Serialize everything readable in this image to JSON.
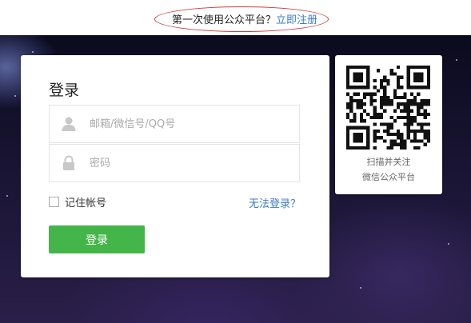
{
  "header": {
    "question": "第一次使用公众平台？",
    "register_link": "立即注册"
  },
  "login": {
    "title": "登录",
    "username_placeholder": "邮箱/微信号/QQ号",
    "password_placeholder": "密码",
    "remember_label": "记住帐号",
    "forgot_link": "无法登录？",
    "submit_label": "登录"
  },
  "qr": {
    "line1": "扫描并关注",
    "line2": "微信公众平台"
  },
  "colors": {
    "accent_green": "#44b549",
    "link_blue": "#3a7bc8",
    "annotation_red": "#d03a3a"
  },
  "icons": [
    "user-icon",
    "lock-icon",
    "qr-code-icon"
  ]
}
